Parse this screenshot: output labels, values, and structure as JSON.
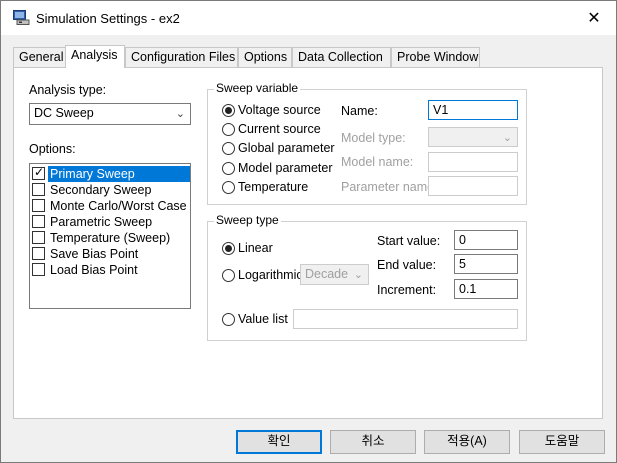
{
  "window": {
    "title": "Simulation Settings - ex2",
    "close_glyph": "✕"
  },
  "tabs": [
    {
      "label": "General"
    },
    {
      "label": "Analysis",
      "active": true
    },
    {
      "label": "Configuration Files"
    },
    {
      "label": "Options"
    },
    {
      "label": "Data Collection"
    },
    {
      "label": "Probe Window"
    }
  ],
  "analysis": {
    "type_label": "Analysis type:",
    "type_value": "DC Sweep",
    "options_label": "Options:",
    "options": [
      {
        "label": "Primary Sweep",
        "checked": true,
        "selected": true
      },
      {
        "label": "Secondary Sweep",
        "checked": false
      },
      {
        "label": "Monte Carlo/Worst Case",
        "checked": false
      },
      {
        "label": "Parametric Sweep",
        "checked": false
      },
      {
        "label": "Temperature (Sweep)",
        "checked": false
      },
      {
        "label": "Save Bias Point",
        "checked": false
      },
      {
        "label": "Load Bias Point",
        "checked": false
      }
    ]
  },
  "sweep_variable": {
    "title": "Sweep variable",
    "radios": [
      {
        "label": "Voltage source",
        "selected": true
      },
      {
        "label": "Current source",
        "selected": false
      },
      {
        "label": "Global parameter",
        "selected": false
      },
      {
        "label": "Model parameter",
        "selected": false
      },
      {
        "label": "Temperature",
        "selected": false
      }
    ],
    "name_label": "Name:",
    "name_value": "V1",
    "model_type_label": "Model type:",
    "model_name_label": "Model name:",
    "parameter_name_label": "Parameter name:"
  },
  "sweep_type": {
    "title": "Sweep type",
    "linear_label": "Linear",
    "log_label": "Logarithmic",
    "log_unit": "Decade",
    "start_label": "Start value:",
    "start_value": "0",
    "end_label": "End value:",
    "end_value": "5",
    "increment_label": "Increment:",
    "increment_value": "0.1",
    "value_list_label": "Value list",
    "value_list_value": "",
    "selected": "Linear"
  },
  "buttons": {
    "ok": "확인",
    "cancel": "취소",
    "apply": "적용(A)",
    "help": "도움말"
  },
  "colors": {
    "accent": "#0078d7",
    "panel_bg": "#ffffff",
    "window_bg": "#f0f0f0"
  }
}
